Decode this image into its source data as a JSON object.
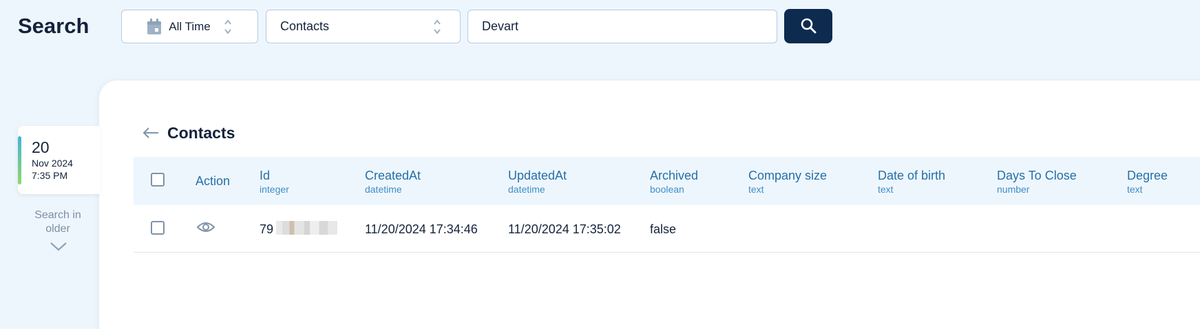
{
  "header": {
    "title": "Search",
    "time_filter": "All Time",
    "entity_filter": "Contacts",
    "search_value": "Devart"
  },
  "date_nav": {
    "day": "20",
    "month": "Nov 2024",
    "time": "7:35 PM",
    "older_label": "Search in older"
  },
  "results": {
    "title": "Contacts",
    "columns": [
      {
        "name": "Action",
        "type": ""
      },
      {
        "name": "Id",
        "type": "integer"
      },
      {
        "name": "CreatedAt",
        "type": "datetime"
      },
      {
        "name": "UpdatedAt",
        "type": "datetime"
      },
      {
        "name": "Archived",
        "type": "boolean"
      },
      {
        "name": "Company size",
        "type": "text"
      },
      {
        "name": "Date of birth",
        "type": "text"
      },
      {
        "name": "Days To Close",
        "type": "number"
      },
      {
        "name": "Degree",
        "type": "text"
      }
    ],
    "rows": [
      {
        "id": "79",
        "created_at": "11/20/2024 17:34:46",
        "updated_at": "11/20/2024 17:35:02",
        "archived": "false"
      }
    ]
  },
  "colors": {
    "accent": "#0d2b4f",
    "column_header": "#2470a8",
    "background": "#eef6fd"
  },
  "icons": [
    "calendar-icon",
    "updown-icon",
    "search-icon",
    "back-arrow-icon",
    "eye-icon",
    "chevron-down-icon"
  ]
}
